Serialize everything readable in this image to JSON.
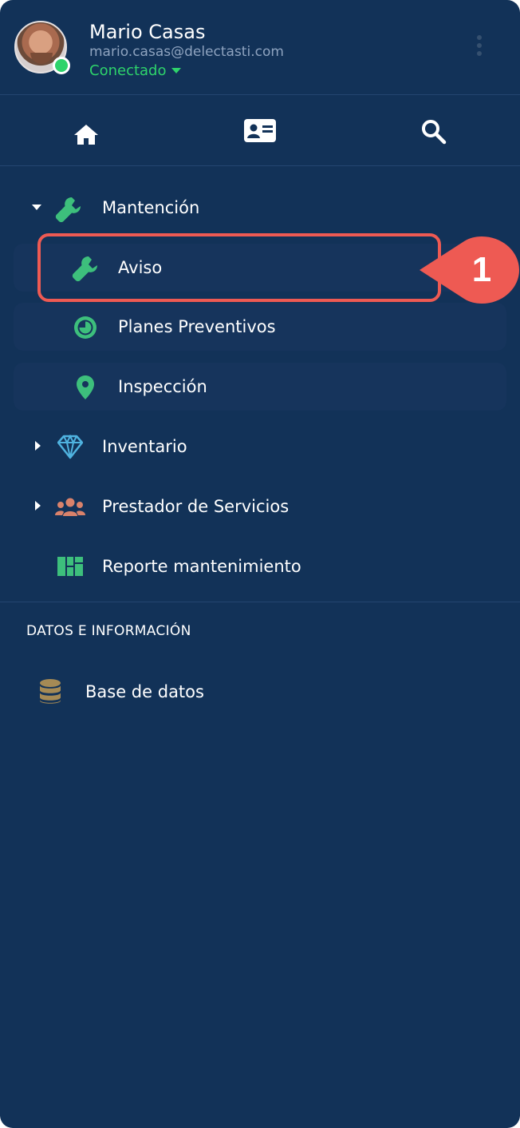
{
  "user": {
    "name": "Mario Casas",
    "email": "mario.casas@delectasti.com",
    "status": "Conectado"
  },
  "toolbar": {
    "icons": [
      "home-icon",
      "contact-card-icon",
      "search-icon"
    ]
  },
  "nav": {
    "mantencion": {
      "label": "Mantención",
      "icon": "wrench-icon",
      "expanded": true,
      "children": [
        {
          "label": "Aviso",
          "icon": "wrench-icon"
        },
        {
          "label": "Planes Preventivos",
          "icon": "pie-clock-icon"
        },
        {
          "label": "Inspección",
          "icon": "map-pin-icon"
        }
      ]
    },
    "inventario": {
      "label": "Inventario",
      "icon": "diamond-icon"
    },
    "prestador": {
      "label": "Prestador de Servicios",
      "icon": "users-icon"
    },
    "reporte": {
      "label": "Reporte mantenimiento",
      "icon": "dashboard-icon"
    }
  },
  "section": {
    "title": "DATOS E INFORMACIÓN",
    "items": [
      {
        "label": "Base de datos",
        "icon": "database-icon"
      }
    ]
  },
  "callout": {
    "number": "1"
  },
  "colors": {
    "panel_bg": "#123258",
    "item_bg": "#16345c",
    "accent_green": "#2ed36b",
    "icon_green": "#3dbf7c",
    "icon_blue": "#4fb3e0",
    "icon_salmon": "#d9826b",
    "icon_gold": "#a58a55",
    "callout_red": "#ee5a53"
  }
}
